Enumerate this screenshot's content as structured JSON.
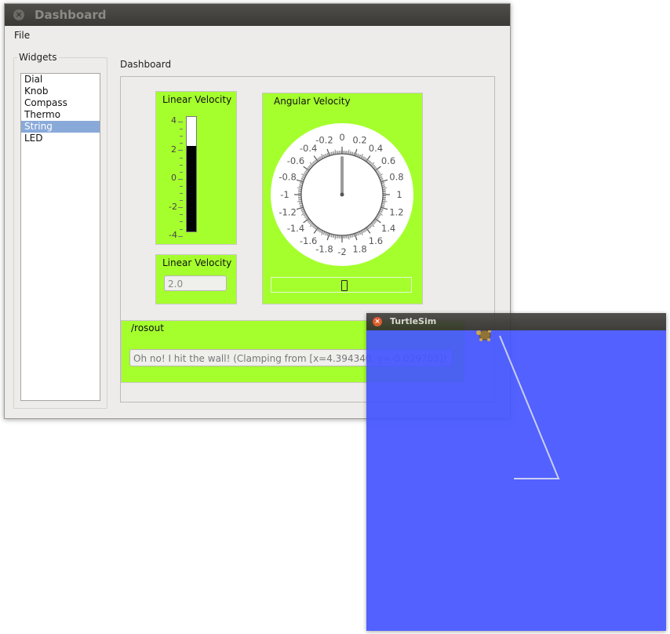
{
  "dashboard_window": {
    "title": "Dashboard",
    "menu": {
      "file": "File"
    }
  },
  "widgets": {
    "group_label": "Widgets",
    "items": [
      "Dial",
      "Knob",
      "Compass",
      "Thermo",
      "String",
      "LED"
    ],
    "selected": "String"
  },
  "dashboard": {
    "label": "Dashboard",
    "linear_velocity_thermo": {
      "title": "Linear Velocity",
      "ticks": [
        "4",
        "2",
        "0",
        "-2",
        "-4"
      ],
      "value": 2.0,
      "range": [
        -4,
        4
      ]
    },
    "linear_velocity_field": {
      "title": "Linear Velocity",
      "value": "2.0"
    },
    "angular_velocity": {
      "title": "Angular Velocity",
      "scale_labels": [
        "0",
        "0.2",
        "0.4",
        "0.6",
        "0.8",
        "1",
        "1.2",
        "1.4",
        "1.6",
        "1.8",
        "-2",
        "-1.8",
        "-1.6",
        "-1.4",
        "-1.2",
        "-1",
        "-0.8",
        "-0.6",
        "-0.4",
        "-0.2"
      ],
      "value": 0,
      "range": [
        -2,
        2
      ],
      "slider_value": 0
    },
    "rosout": {
      "title": "/rosout",
      "message": "Oh no! I hit the wall! (Clamping from [x=4.394340, y=-0.029703])"
    }
  },
  "turtlesim_window": {
    "title": "TurtleSim",
    "background_color": "#4556ff",
    "path_color": "#c8ccf0"
  },
  "colors": {
    "widget_green": "#a5ff2d",
    "selection_blue": "#89a9d9"
  }
}
